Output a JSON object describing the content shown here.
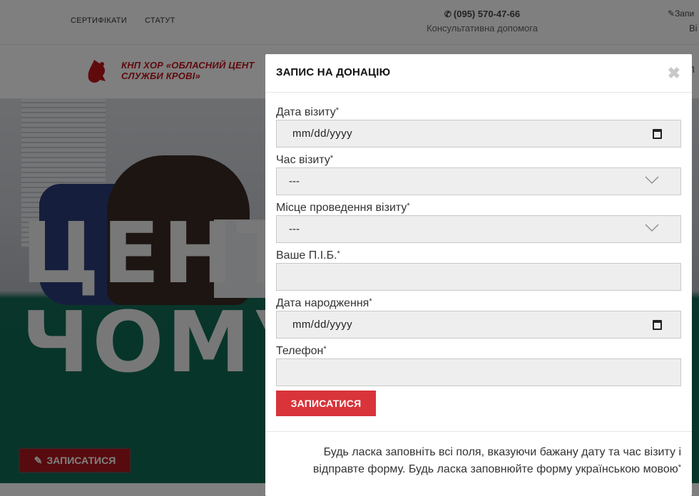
{
  "top_nav": {
    "items": [
      "СЕРТИФІКАТИ",
      "СТАТУТ"
    ],
    "phone": "(095) 570-47-66",
    "phone_hint": "Консультативна допомога",
    "record_link": "Запи",
    "record_link_sub": "Ві"
  },
  "logo": {
    "line1": "КНП ХОР «ОБЛАСНИЙ ЦЕНТ",
    "line2": "СЛУЖБИ КРОВІ»",
    "right_fragment": "БЛ",
    "brand_color": "#c0141c"
  },
  "hero": {
    "text_line1": "ЦЕНТР",
    "text_line2": "ЧОМУ",
    "cta_label": "ЗАПИСАТИСЯ",
    "cta_icon": "pencil-icon"
  },
  "modal": {
    "title": "ЗАПИС НА ДОНАЦІЮ",
    "close_icon": "close-icon",
    "fields": [
      {
        "label": "Дата візиту",
        "required_mark": "*",
        "type": "date",
        "value": "mm/dd/yyyy"
      },
      {
        "label": "Час візиту",
        "required_mark": "*",
        "type": "select",
        "value": "---"
      },
      {
        "label": "Місце проведення візиту",
        "required_mark": "*",
        "type": "select",
        "value": "---"
      },
      {
        "label": "Ваше П.І.Б.",
        "required_mark": "*",
        "type": "text",
        "value": ""
      },
      {
        "label": "Дата народження",
        "required_mark": "*",
        "type": "date",
        "value": "mm/dd/yyyy"
      },
      {
        "label": "Телефон",
        "required_mark": "*",
        "type": "text",
        "value": ""
      }
    ],
    "submit_label": "ЗАПИСАТИСЯ",
    "submit_color": "#d8343a",
    "footer_note_line1": "Будь ласка заповніть всі поля, вказуючи бажану дату та час візиту і",
    "footer_note_line2": "відправте форму. Будь ласка заповнюйте форму українською мовою",
    "footer_note_mark": "*"
  }
}
